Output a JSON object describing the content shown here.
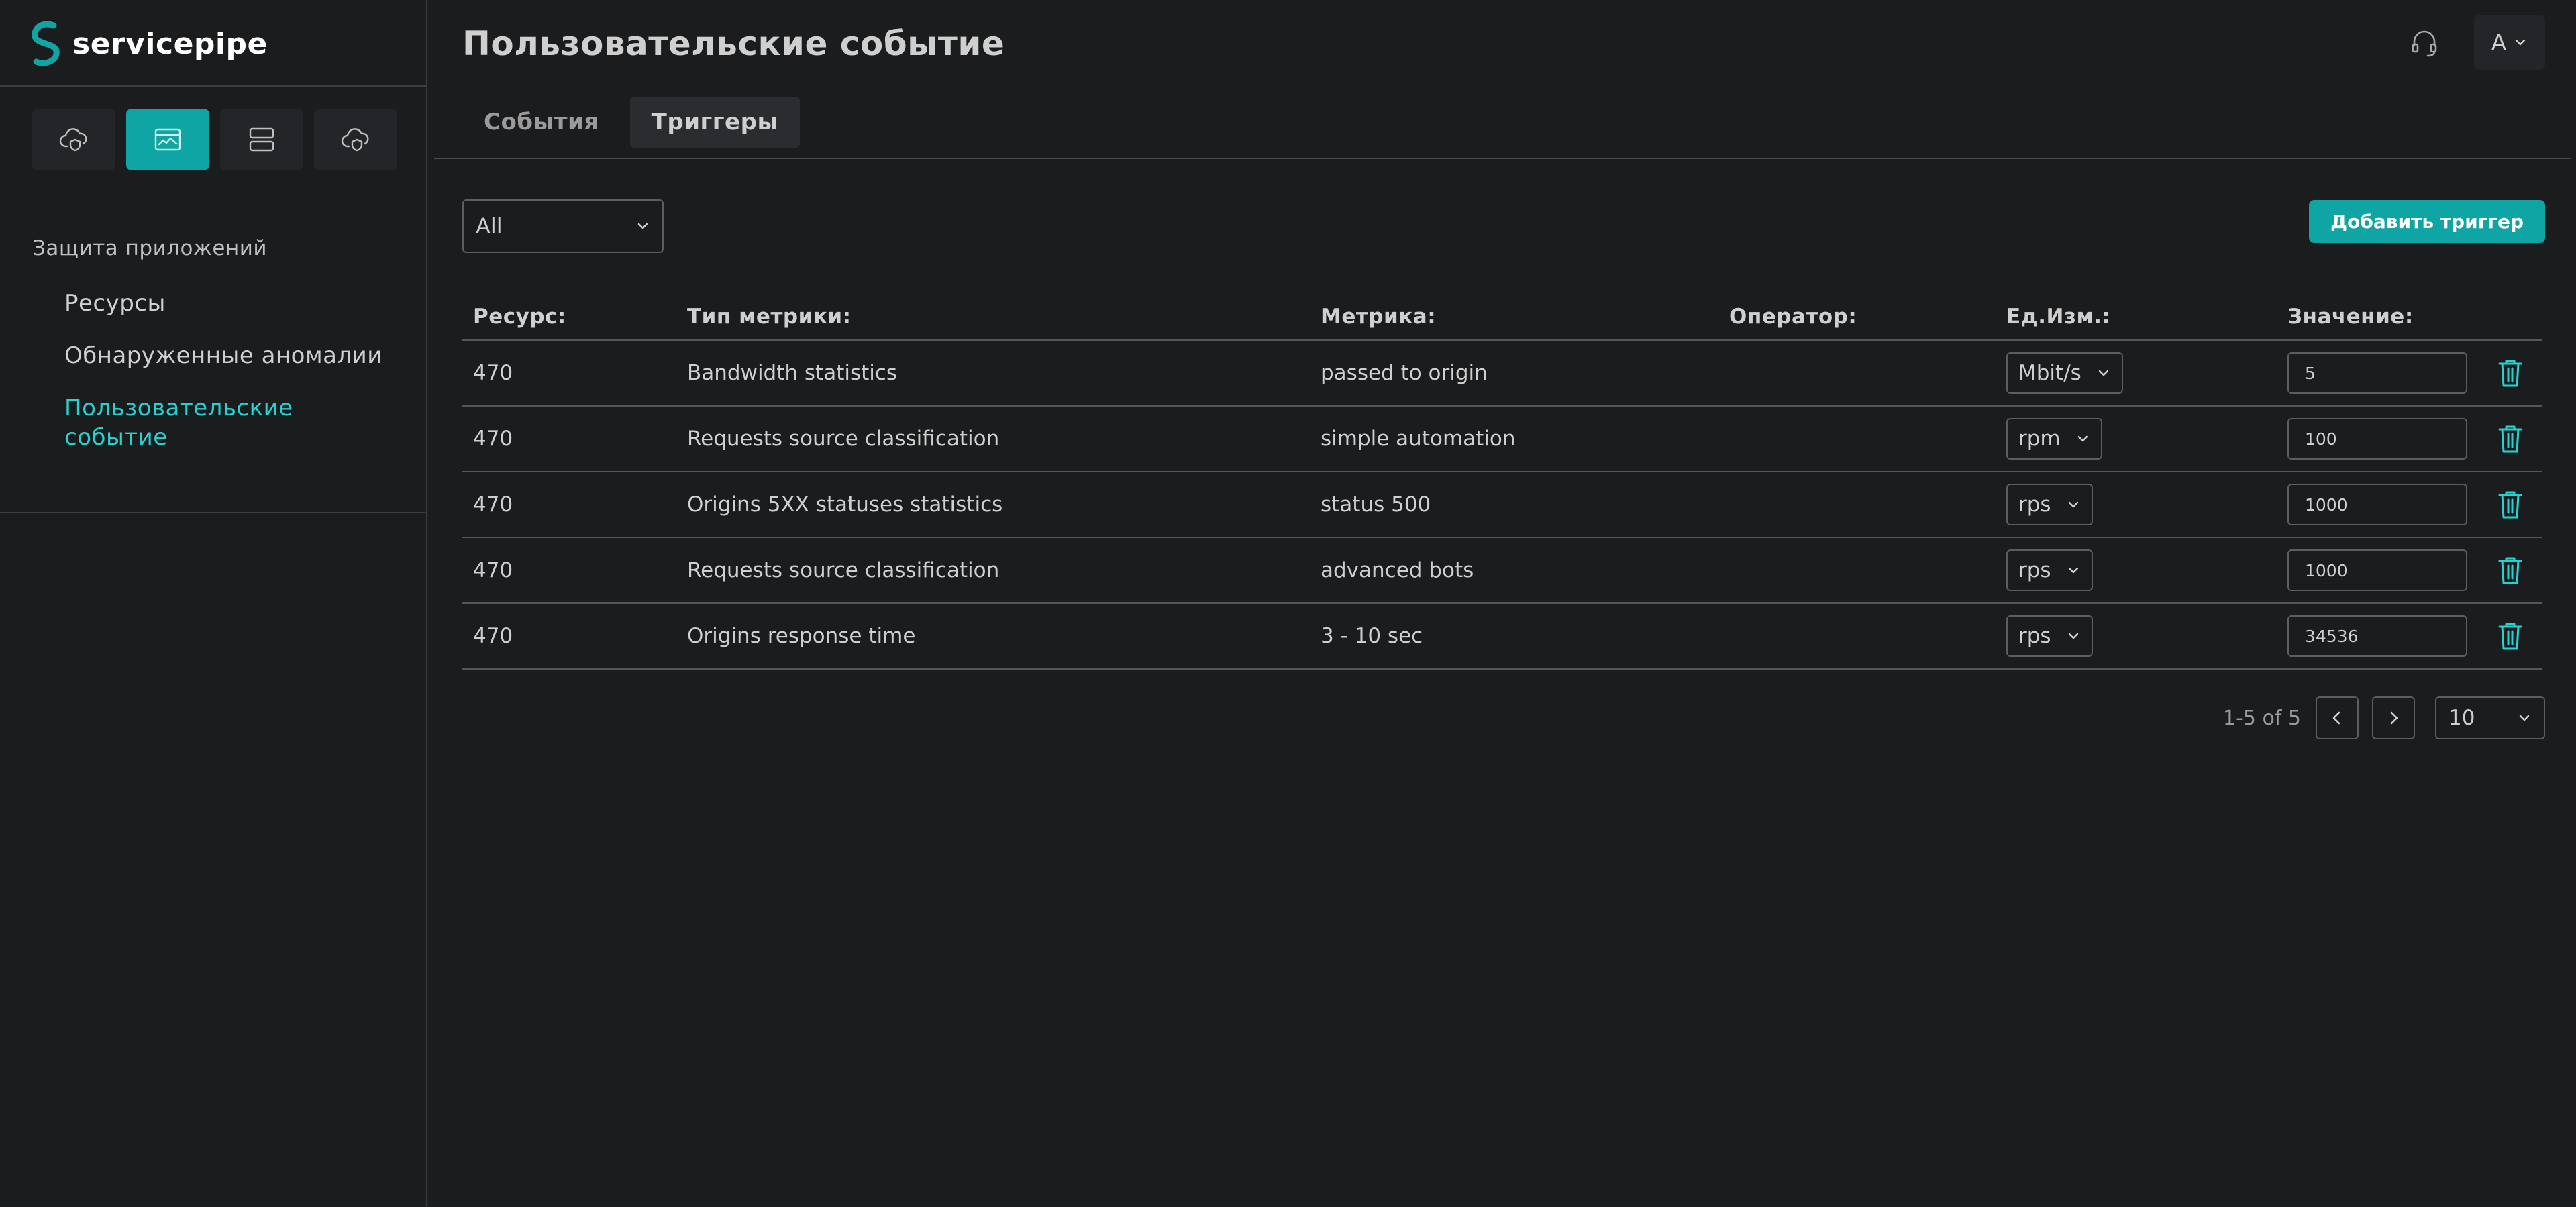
{
  "colors": {
    "background": "#1b1c1e",
    "accent": "#0ea5a4",
    "accent_text": "#27d3d0",
    "panel": "#242528",
    "border": "#5c5d60"
  },
  "brand": {
    "name": "servicepipe",
    "logo_icon": "servicepipe-logo"
  },
  "sidebar": {
    "modules": [
      {
        "icon": "cloud-shield-icon",
        "active": false
      },
      {
        "icon": "app-window-icon",
        "active": true
      },
      {
        "icon": "server-icon",
        "active": false
      },
      {
        "icon": "cloud-shield-alt-icon",
        "active": false
      }
    ],
    "section_label": "Защита приложений",
    "nav": [
      {
        "label": "Ресурсы",
        "active": false
      },
      {
        "label": "Обнаруженные аномалии",
        "active": false
      },
      {
        "label": "Пользовательские событие",
        "active": true
      }
    ]
  },
  "header": {
    "title": "Пользовательские событие",
    "support_icon": "headset-icon",
    "user_initial": "A"
  },
  "tabs": [
    {
      "label": "События",
      "active": false
    },
    {
      "label": "Триггеры",
      "active": true
    }
  ],
  "filter": {
    "value": "All"
  },
  "add_button": {
    "label": "Добавить триггер"
  },
  "table": {
    "columns": {
      "resource": "Ресурс:",
      "metric_type": "Тип метрики:",
      "metric": "Метрика:",
      "operator": "Оператор:",
      "unit": "Ед.Изм.:",
      "value": "Значение:"
    },
    "rows": [
      {
        "resource": "470",
        "metric_type": "Bandwidth statistics",
        "metric": "passed to origin",
        "operator": "",
        "unit": "Mbit/s",
        "value": "5"
      },
      {
        "resource": "470",
        "metric_type": "Requests source classification",
        "metric": "simple automation",
        "operator": "",
        "unit": "rpm",
        "value": "100"
      },
      {
        "resource": "470",
        "metric_type": "Origins 5XX statuses statistics",
        "metric": "status 500",
        "operator": "",
        "unit": "rps",
        "value": "1000"
      },
      {
        "resource": "470",
        "metric_type": "Requests source classification",
        "metric": "advanced bots",
        "operator": "",
        "unit": "rps",
        "value": "1000"
      },
      {
        "resource": "470",
        "metric_type": "Origins response time",
        "metric": "3 - 10 sec",
        "operator": "",
        "unit": "rps",
        "value": "34536"
      }
    ]
  },
  "pagination": {
    "info": "1-5 of 5",
    "page_size": "10"
  }
}
